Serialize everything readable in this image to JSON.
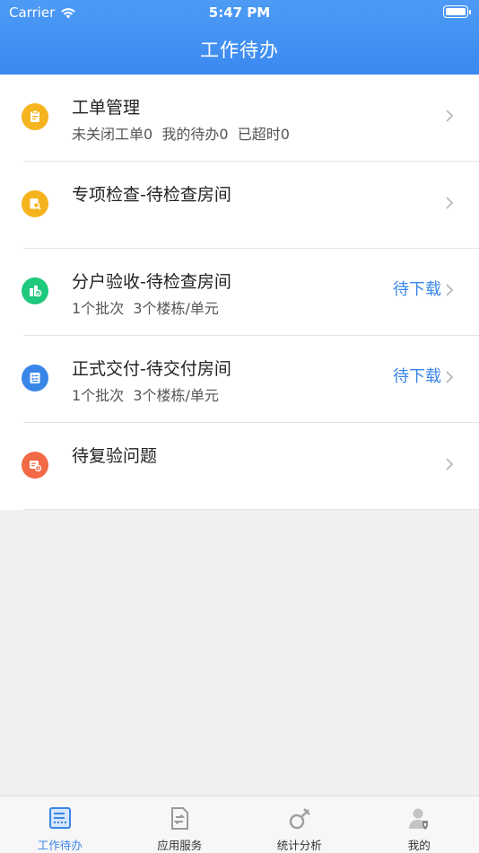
{
  "status_bar": {
    "carrier": "Carrier",
    "time": "5:47 PM"
  },
  "header": {
    "title": "工作待办"
  },
  "list": [
    {
      "title": "工单管理",
      "subtitle": "未关闭工单0  我的待办0  已超时0",
      "status": "",
      "icon": "clipboard-icon",
      "color": "#f5b41d"
    },
    {
      "title": "专项检查-待检查房间",
      "subtitle": "",
      "status": "",
      "icon": "inspect-icon",
      "color": "#f5b41d"
    },
    {
      "title": "分户验收-待检查房间",
      "subtitle": "1个批次  3个楼栋/单元",
      "status": "待下载",
      "icon": "acceptance-icon",
      "color": "#1ec97c"
    },
    {
      "title": "正式交付-待交付房间",
      "subtitle": "1个批次  3个楼栋/单元",
      "status": "待下载",
      "icon": "delivery-icon",
      "color": "#3a86e8"
    },
    {
      "title": "待复验问题",
      "subtitle": "",
      "status": "",
      "icon": "recheck-icon",
      "color": "#f26a45"
    }
  ],
  "tabbar": {
    "items": [
      {
        "label": "工作待办",
        "icon": "todo-list-icon",
        "active": true
      },
      {
        "label": "应用服务",
        "icon": "app-service-icon",
        "active": false
      },
      {
        "label": "统计分析",
        "icon": "statistics-icon",
        "active": false
      },
      {
        "label": "我的",
        "icon": "profile-icon",
        "active": false
      }
    ]
  },
  "colors": {
    "accent": "#3a86e8",
    "header": "#3f8df2"
  }
}
